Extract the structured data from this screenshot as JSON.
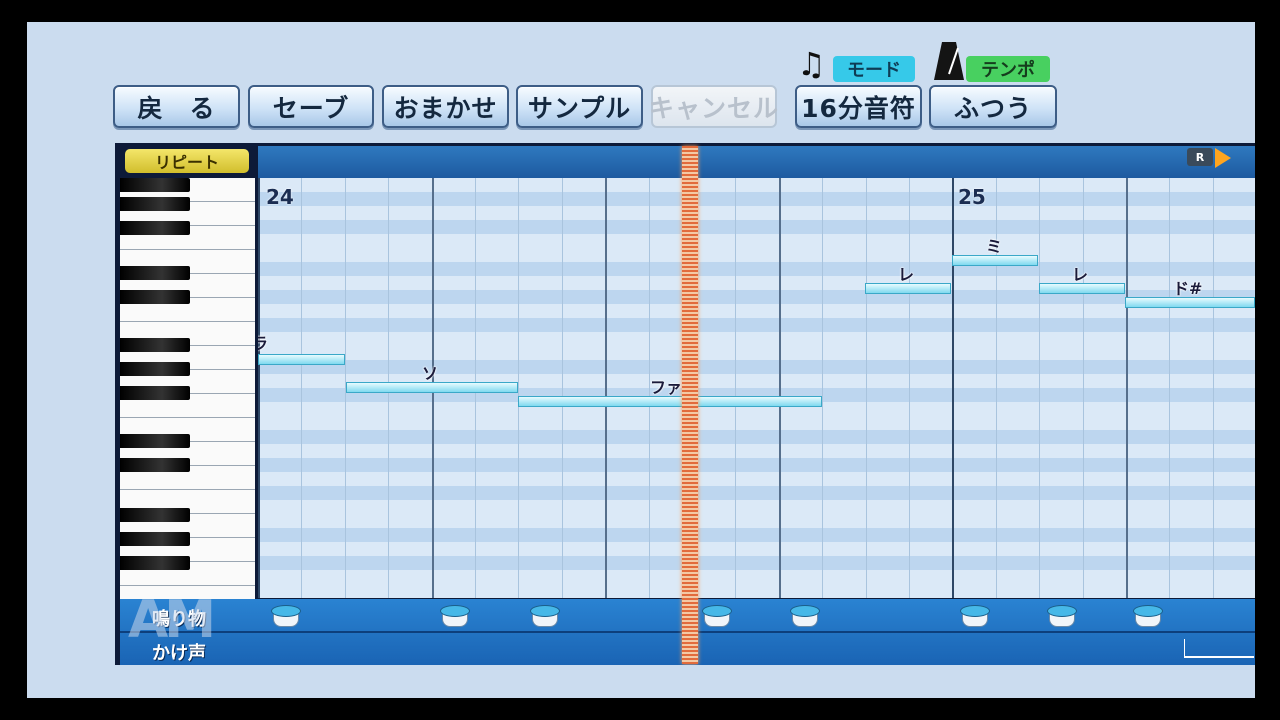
{
  "toolbar": {
    "back": "戻　る",
    "save": "セーブ",
    "auto": "おまかせ",
    "sample": "サンプル",
    "cancel": "キャンセル",
    "mode_label": "モード",
    "mode_value": "16分音符",
    "tempo_label": "テンポ",
    "tempo_value": "ふつう"
  },
  "icons": {
    "mode": "music-note-icon",
    "tempo": "metronome-icon"
  },
  "editor": {
    "repeat": "リピート",
    "loop_marker": "R",
    "bars": [
      "24",
      "25"
    ],
    "notes": [
      {
        "label": "ラ"
      },
      {
        "label": "ソ"
      },
      {
        "label": "ファ#"
      },
      {
        "label": "レ"
      },
      {
        "label": "ミ"
      },
      {
        "label": "レ"
      },
      {
        "label": "ド#"
      }
    ],
    "drum_labels": [
      "鳴り物",
      "かけ声"
    ]
  },
  "watermark": "AM",
  "colors": {
    "accent": "#36c9e9",
    "tempo": "#48d060",
    "note": "#8fe0f3",
    "repeat": "#e8d84a",
    "playhead": "#e26b3c"
  }
}
